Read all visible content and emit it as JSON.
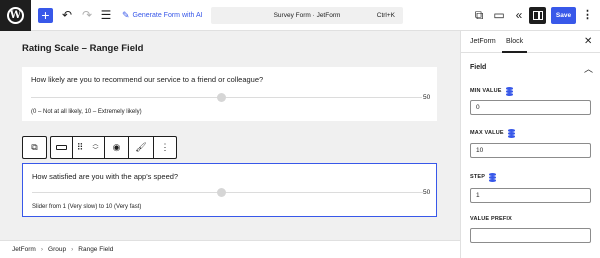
{
  "topbar": {
    "generate_label": "Generate Form with AI",
    "document_title": "Survey Form · JetForm",
    "shortcut": "Ctrl+K",
    "save_label": "Save",
    "icons": [
      "wordpress-logo",
      "plus-icon",
      "undo-icon",
      "redo-icon",
      "list-view-icon",
      "sparkle-icon",
      "external-link-icon",
      "preview-icon",
      "collapse-icon",
      "settings-panel-icon",
      "more-vertical-icon"
    ]
  },
  "canvas": {
    "form_title": "Rating Scale – Range Field",
    "fields": [
      {
        "label": "How likely are you to recommend our service to a friend or colleague?",
        "value": "50",
        "description": "(0 – Not at all likely, 10 – Extremely likely)"
      },
      {
        "label": "How satisfied are you with the app's speed?",
        "value": "50",
        "description": "Slider from 1 (Very slow) to 10 (Very fast)"
      }
    ]
  },
  "breadcrumb": [
    "JetForm",
    "Group",
    "Range Field"
  ],
  "sidebar": {
    "tabs": [
      "JetForm",
      "Block"
    ],
    "active_tab": "Block",
    "section_title": "Field",
    "min_label": "MIN VALUE",
    "min_value": "0",
    "max_label": "MAX VALUE",
    "max_value": "10",
    "step_label": "STEP",
    "step_value": "1",
    "prefix_label": "VALUE PREFIX"
  },
  "colors": {
    "accent": "#3858e9",
    "dark": "#1e1e1e",
    "canvas_bg": "#f0f0f0"
  }
}
